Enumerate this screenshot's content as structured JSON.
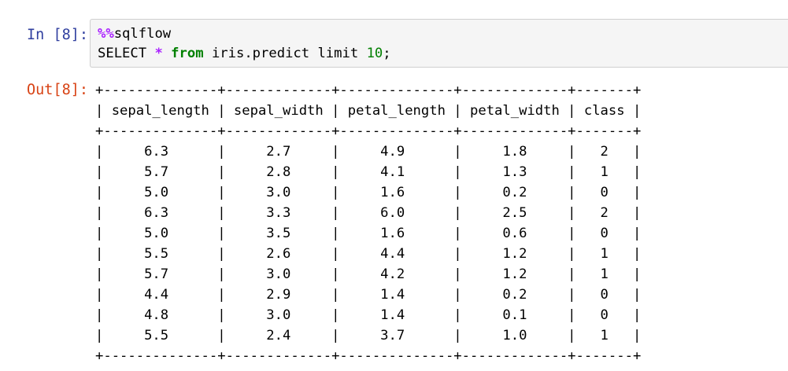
{
  "cell": {
    "in_prompt": "In [8]:",
    "out_prompt": "Out[8]:",
    "code": {
      "magic_prefix": "%%",
      "magic_name": "sqlflow",
      "select_kw": "SELECT",
      "star": "*",
      "from_kw": "from",
      "table_and_limit": "iris.predict limit",
      "limit_value": "10",
      "terminator": ";"
    }
  },
  "output": {
    "lines": [
      "+--------------+-------------+--------------+-------------+-------+",
      "| sepal_length | sepal_width | petal_length | petal_width | class |",
      "+--------------+-------------+--------------+-------------+-------+",
      "|     6.3      |     2.7     |     4.9      |     1.8     |   2   |",
      "|     5.7      |     2.8     |     4.1      |     1.3     |   1   |",
      "|     5.0      |     3.0     |     1.6      |     0.2     |   0   |",
      "|     6.3      |     3.3     |     6.0      |     2.5     |   2   |",
      "|     5.0      |     3.5     |     1.6      |     0.6     |   0   |",
      "|     5.5      |     2.6     |     4.4      |     1.2     |   1   |",
      "|     5.7      |     3.0     |     4.2      |     1.2     |   1   |",
      "|     4.4      |     2.9     |     1.4      |     0.2     |   0   |",
      "|     4.8      |     3.0     |     1.4      |     0.1     |   0   |",
      "|     5.5      |     2.4     |     3.7      |     1.0     |   1   |",
      "+--------------+-------------+--------------+-------------+-------+"
    ]
  },
  "colors": {
    "in_prompt": "#303f9f",
    "out_prompt": "#d84315",
    "magic": "#aa22ff",
    "keyword": "#008000",
    "input_bg": "#f5f5f5",
    "input_border": "#cfcfcf"
  }
}
